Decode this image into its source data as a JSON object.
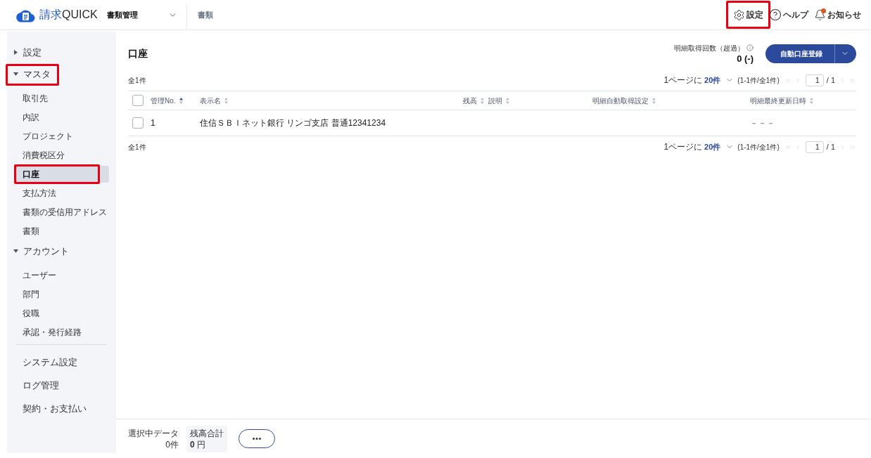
{
  "header": {
    "logo": {
      "name": "請求",
      "suffix": "QUICK"
    },
    "module_select": {
      "value": "書類管理"
    },
    "breadcrumb": "書類",
    "actions": [
      {
        "kind": "settings",
        "label": "設定",
        "highlighted": true,
        "unread": false
      },
      {
        "kind": "help",
        "label": "ヘルプ",
        "highlighted": false,
        "unread": false
      },
      {
        "kind": "notifications",
        "label": "お知らせ",
        "highlighted": false,
        "unread": true
      }
    ]
  },
  "sidebar": {
    "sections": [
      {
        "label": "設定",
        "expanded": false,
        "highlighted": false
      },
      {
        "label": "マスタ",
        "expanded": true,
        "highlighted": true,
        "children": [
          {
            "label": "取引先",
            "selected": false,
            "highlighted": false
          },
          {
            "label": "内訳",
            "selected": false,
            "highlighted": false
          },
          {
            "label": "プロジェクト",
            "selected": false,
            "highlighted": false
          },
          {
            "label": "消費税区分",
            "selected": false,
            "highlighted": false
          },
          {
            "label": "口座",
            "selected": true,
            "highlighted": true
          },
          {
            "label": "支払方法",
            "selected": false,
            "highlighted": false
          },
          {
            "label": "書類の受信用アドレス",
            "selected": false,
            "highlighted": false
          },
          {
            "label": "書類",
            "selected": false,
            "highlighted": false
          }
        ]
      },
      {
        "label": "アカウント",
        "expanded": true,
        "highlighted": false,
        "children": [
          {
            "label": "ユーザー",
            "selected": false,
            "highlighted": false
          },
          {
            "label": "部門",
            "selected": false,
            "highlighted": false
          },
          {
            "label": "役職",
            "selected": false,
            "highlighted": false
          },
          {
            "label": "承認・発行経路",
            "selected": false,
            "highlighted": false
          }
        ]
      }
    ],
    "links": [
      "システム設定",
      "ログ管理",
      "契約・お支払い"
    ]
  },
  "page": {
    "title": "口座",
    "fetch_count": {
      "label": "明細取得回数（超過）",
      "value": "0 (-)"
    },
    "primary_button": {
      "label": "自動口座登録"
    }
  },
  "table": {
    "count_top": "全1件",
    "pagination_top": {
      "per_page_label": "1ページに",
      "per_page": "20件",
      "range": "(1-1件/全1件)",
      "page": "1",
      "total_pages": "/ 1",
      "nav_disabled": true
    },
    "select_all": {
      "checked": false
    },
    "columns": [
      {
        "label": "管理No.",
        "sorted_ascending": true
      },
      {
        "label": "表示名",
        "sorted_ascending": false
      },
      {
        "label": "残高",
        "sorted_ascending": false
      },
      {
        "label": "説明",
        "sorted_ascending": false
      },
      {
        "label": "明細自動取得設定",
        "sorted_ascending": false
      },
      {
        "label": "明細最終更新日時",
        "sorted_ascending": false
      }
    ],
    "rows": [
      {
        "checked": false,
        "no": "1",
        "display_name": "住信ＳＢＩネット銀行 リンゴ支店 普通12341234",
        "last_updated": "－－－"
      }
    ],
    "count_bottom": "全1件",
    "pagination_bottom": {
      "per_page_label": "1ページに",
      "per_page": "20件",
      "range": "(1-1件/全1件)",
      "page": "1",
      "total_pages": "/ 1",
      "nav_disabled": true
    }
  },
  "footer": {
    "selected_label": "選択中データ",
    "selected_count": "0件",
    "balance_label": "残高合計",
    "balance_value": "0",
    "balance_unit": "円"
  }
}
